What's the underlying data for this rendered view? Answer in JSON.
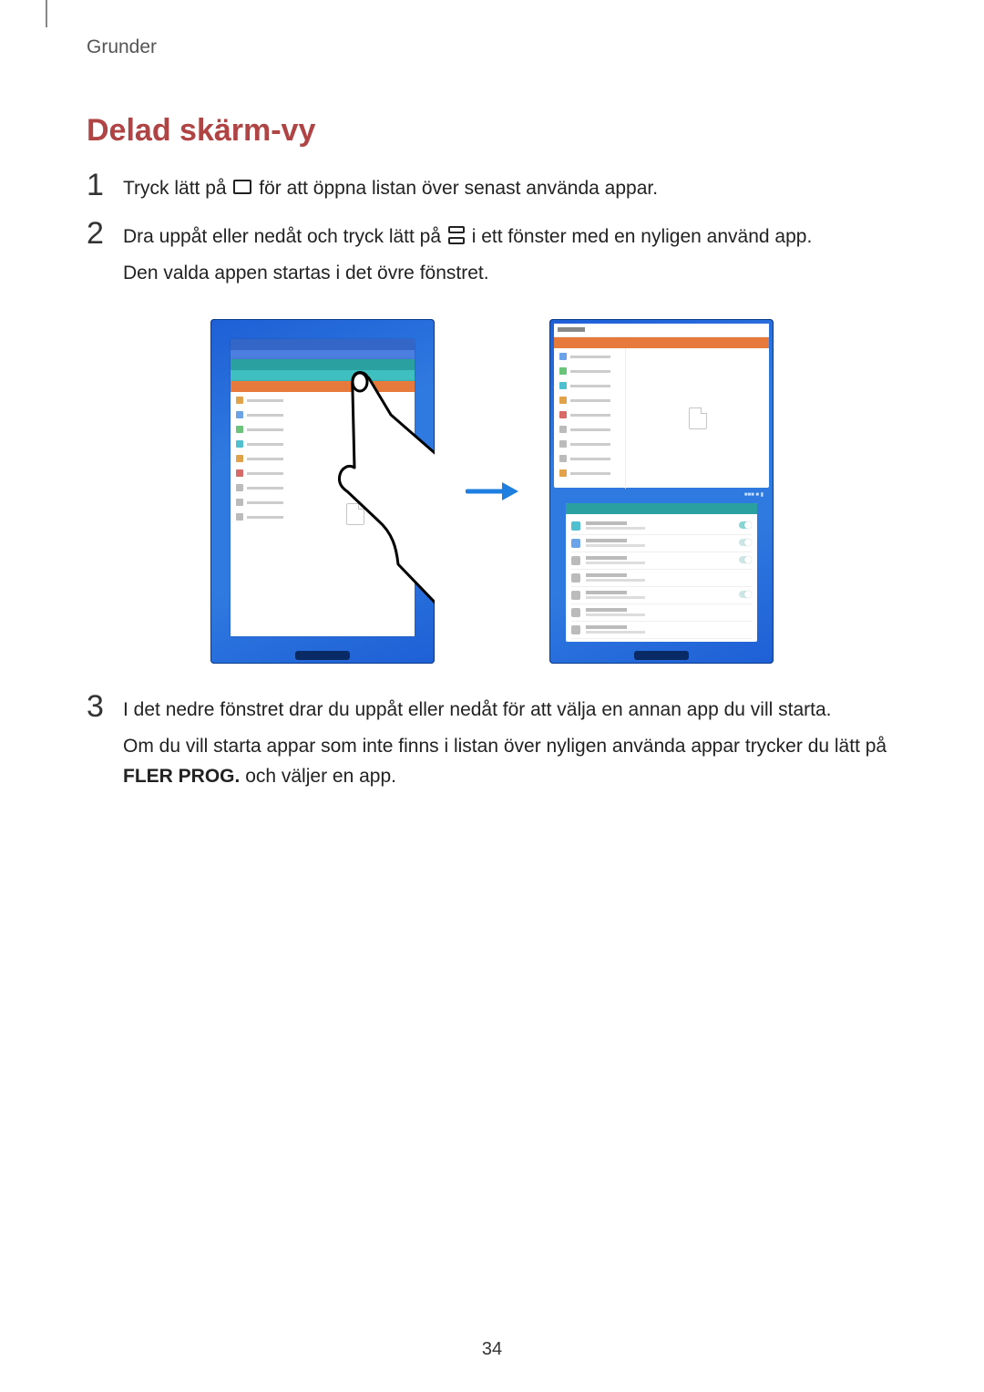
{
  "header": {
    "breadcrumb": "Grunder"
  },
  "heading": "Delad skärm-vy",
  "steps": {
    "s1": {
      "num": "1",
      "t_before": "Tryck lätt på ",
      "t_after": " för att öppna listan över senast använda appar."
    },
    "s2": {
      "num": "2",
      "t_before": "Dra uppåt eller nedåt och tryck lätt på ",
      "t_after": " i ett fönster med en nyligen använd app.",
      "t_line2": "Den valda appen startas i det övre fönstret."
    },
    "s3": {
      "num": "3",
      "t_line1": "I det nedre fönstret drar du uppåt eller nedåt för att välja en annan app du vill starta.",
      "t_line2a": "Om du vill starta appar som inte finns i listan över nyligen använda appar trycker du lätt på ",
      "t_line2_bold": "FLER PROG.",
      "t_line2b": " och väljer en app."
    }
  },
  "pageNumber": "34"
}
